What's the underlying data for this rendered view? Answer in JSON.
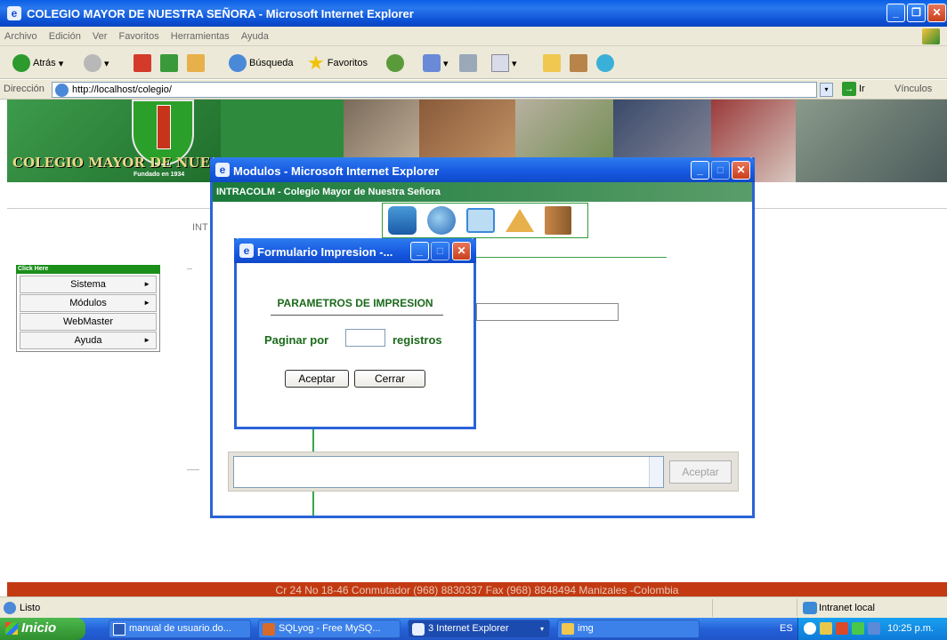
{
  "browser": {
    "title": "COLEGIO MAYOR DE NUESTRA SEÑORA - Microsoft Internet Explorer",
    "menu": [
      "Archivo",
      "Edición",
      "Ver",
      "Favoritos",
      "Herramientas",
      "Ayuda"
    ],
    "toolbar": {
      "back": "Atrás",
      "search": "Búsqueda",
      "favorites": "Favoritos"
    },
    "address_label": "Dirección",
    "address": "http://localhost/colegio/",
    "go": "Ir",
    "links": "Vínculos"
  },
  "site": {
    "name": "COLEGIO MAYOR DE NUE",
    "founded": "Fundado en 1934",
    "intro_stub": "INT",
    "sidebar_header": "Click Here",
    "sidebar_items": [
      {
        "label": "Sistema",
        "arrow": "►"
      },
      {
        "label": "Módulos",
        "arrow": "►"
      },
      {
        "label": "WebMaster",
        "arrow": ""
      },
      {
        "label": "Ayuda",
        "arrow": "►"
      }
    ],
    "footer": "Cr 24 No 18-46 Conmutador (968) 8830337 Fax (968) 8848494 Manizales -Colombia"
  },
  "modulos_window": {
    "title": "Modulos - Microsoft Internet Explorer",
    "header": "INTRACOLM - Colegio Mayor de Nuestra Señora",
    "accept": "Aceptar"
  },
  "form_dialog": {
    "title": "Formulario Impresion -...",
    "heading": "PARAMETROS DE IMPRESION",
    "paginate_label": "Paginar por",
    "paginate_value": "",
    "records_label": "registros",
    "accept": "Aceptar",
    "close": "Cerrar"
  },
  "status": {
    "text": "Listo",
    "zone": "Intranet local"
  },
  "taskbar": {
    "start": "Inicio",
    "tasks": [
      "manual de usuario.do...",
      "SQLyog - Free MySQ...",
      "3 Internet Explorer",
      "img"
    ],
    "lang": "ES",
    "clock": "10:25 p.m."
  }
}
